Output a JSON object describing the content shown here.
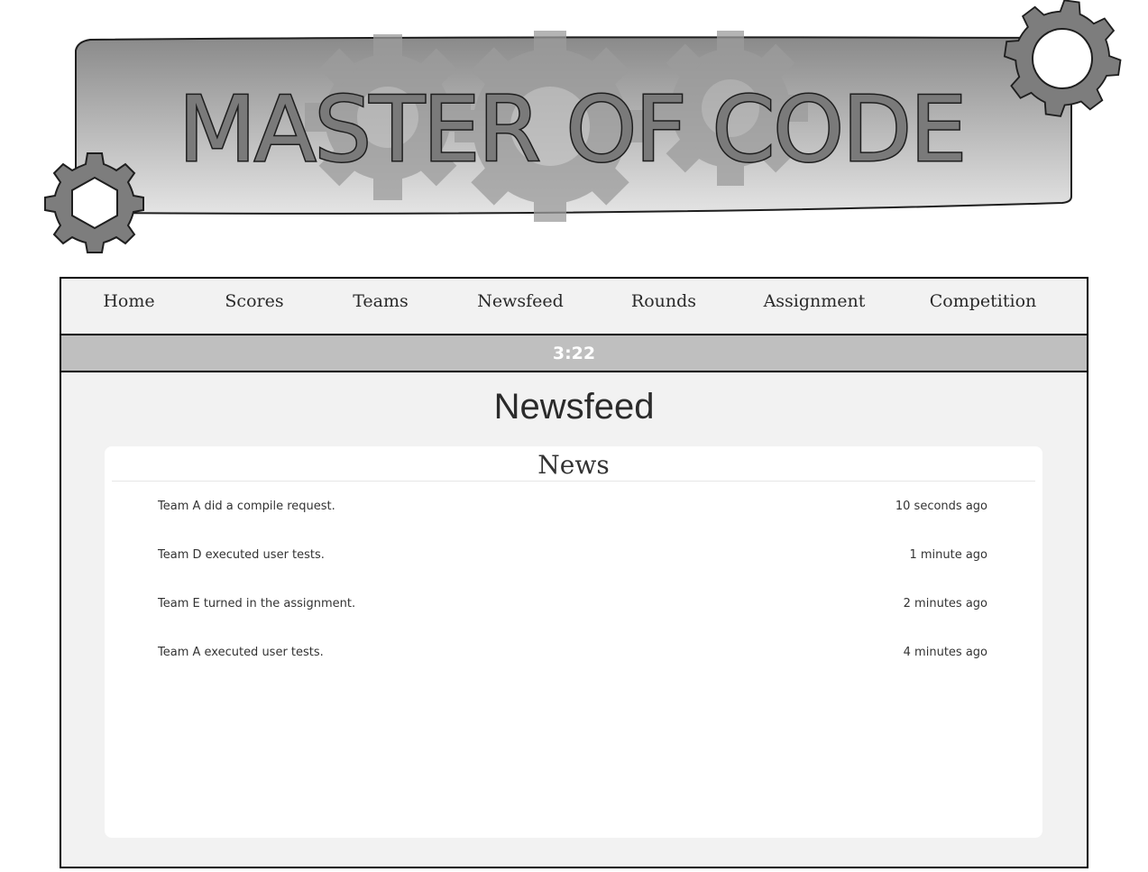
{
  "banner": {
    "title": "MASTER OF CODE"
  },
  "nav": {
    "items": [
      {
        "label": "Home"
      },
      {
        "label": "Scores"
      },
      {
        "label": "Teams"
      },
      {
        "label": "Newsfeed"
      },
      {
        "label": "Rounds"
      },
      {
        "label": "Assignment"
      },
      {
        "label": "Competition"
      }
    ]
  },
  "timer": "3:22",
  "page": {
    "title": "Newsfeed"
  },
  "news": {
    "heading": "News",
    "items": [
      {
        "text": "Team A did a compile request.",
        "time": "10 seconds ago"
      },
      {
        "text": "Team D executed user tests.",
        "time": "1 minute ago"
      },
      {
        "text": "Team E turned in the assignment.",
        "time": "2 minutes ago"
      },
      {
        "text": "Team A executed user tests.",
        "time": "4 minutes ago"
      }
    ]
  }
}
